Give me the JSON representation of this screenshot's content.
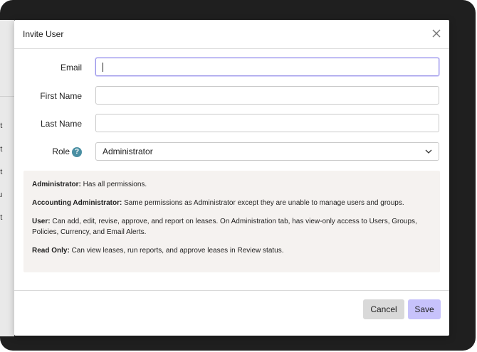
{
  "background": {
    "fragments": [
      "on",
      "ent",
      "ent",
      "ent",
      "ntu",
      "ent"
    ]
  },
  "modal": {
    "title": "Invite User"
  },
  "form": {
    "email": {
      "label": "Email",
      "value": ""
    },
    "first_name": {
      "label": "First Name",
      "value": ""
    },
    "last_name": {
      "label": "Last Name",
      "value": ""
    },
    "role": {
      "label": "Role",
      "help": "?",
      "value": "Administrator"
    }
  },
  "roles_info": [
    {
      "name": "Administrator:",
      "desc": " Has all permissions."
    },
    {
      "name": "Accounting Administrator:",
      "desc": " Same permissions as Administrator except they are unable to manage users and groups."
    },
    {
      "name": "User:",
      "desc": " Can add, edit, revise, approve, and report on leases. On Administration tab, has view-only access to Users, Groups, Policies, Currency, and Email Alerts."
    },
    {
      "name": "Read Only:",
      "desc": " Can view leases, run reports, and approve leases in Review status."
    }
  ],
  "footer": {
    "cancel_label": "Cancel",
    "save_label": "Save"
  },
  "colors": {
    "accent": "#c7c2fb",
    "help_icon": "#4a8fa3",
    "info_bg": "#f5f2f0"
  }
}
